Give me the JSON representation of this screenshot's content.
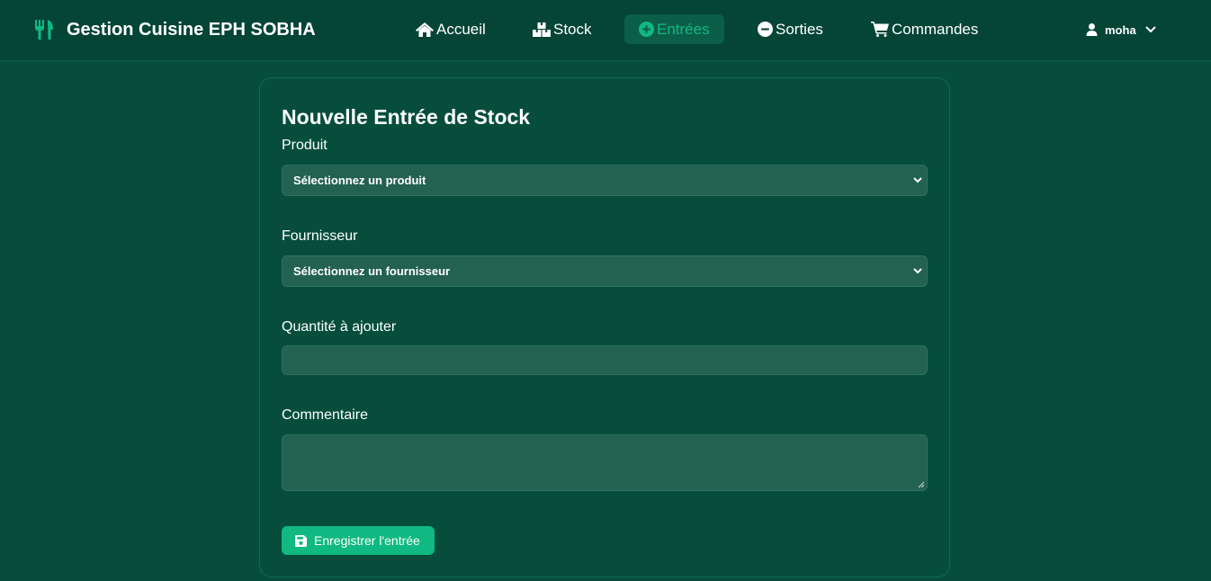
{
  "app": {
    "title": "Gestion Cuisine EPH SOBHA",
    "logo_icon": "utensils-icon"
  },
  "nav": {
    "home": {
      "label": "Accueil",
      "icon": "home-icon"
    },
    "stock": {
      "label": "Stock",
      "icon": "boxes-icon"
    },
    "entries": {
      "label": "Entrées",
      "icon": "plus-circle-icon",
      "active": true
    },
    "exits": {
      "label": "Sorties",
      "icon": "minus-circle-icon"
    },
    "orders": {
      "label": "Commandes",
      "icon": "shopping-cart-icon"
    }
  },
  "user": {
    "name": "moha",
    "icon": "user-icon"
  },
  "form": {
    "title": "Nouvelle Entrée de Stock",
    "product": {
      "label": "Produit",
      "selected": "Sélectionnez un produit"
    },
    "supplier": {
      "label": "Fournisseur",
      "selected": "Sélectionnez un fournisseur"
    },
    "quantity": {
      "label": "Quantité à ajouter",
      "value": ""
    },
    "comment": {
      "label": "Commentaire",
      "value": ""
    },
    "submit_label": "Enregistrer l'entrée"
  },
  "colors": {
    "background": "#064e3b",
    "navbar": "#054536",
    "accent": "#10b981",
    "field": "#236150"
  }
}
